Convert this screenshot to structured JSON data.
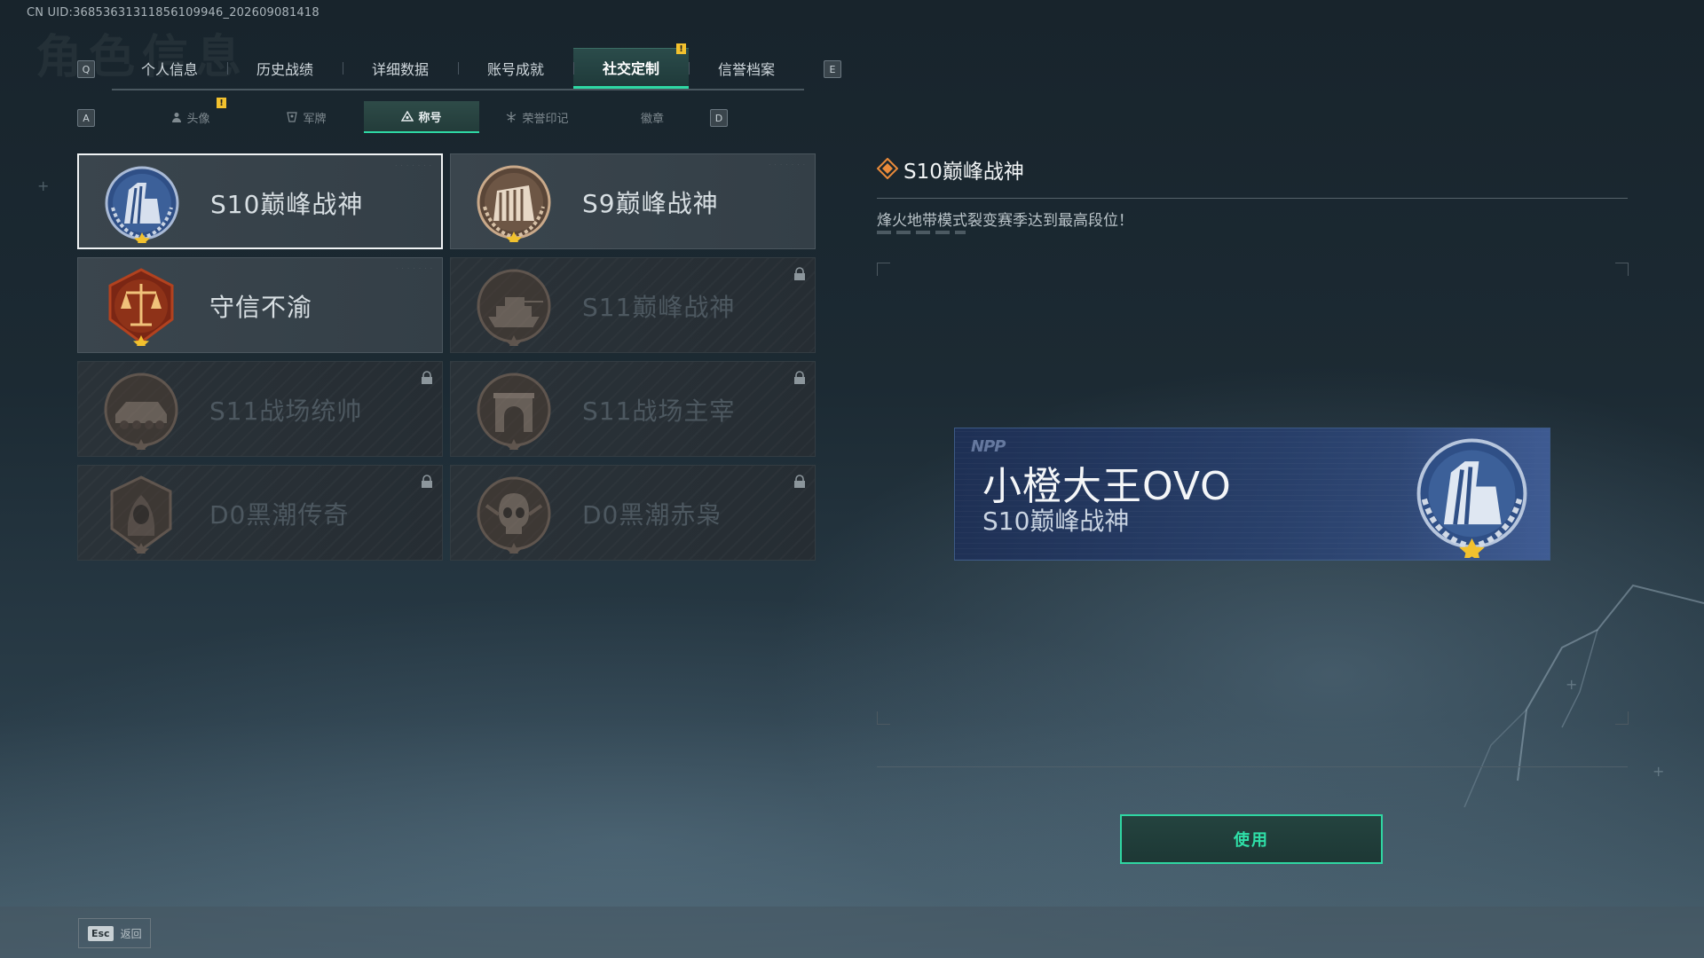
{
  "uid": "CN UID:36853631311856109946_202609081418",
  "keys": {
    "prev_main": "Q",
    "next_main": "E",
    "prev_sub": "A",
    "next_sub": "D"
  },
  "main_tabs": [
    {
      "label": "个人信息"
    },
    {
      "label": "历史战绩"
    },
    {
      "label": "详细数据"
    },
    {
      "label": "账号成就"
    },
    {
      "label": "社交定制",
      "active": true
    },
    {
      "label": "信誉档案"
    }
  ],
  "sub_tabs": [
    {
      "label": "头像",
      "icon": "person-icon"
    },
    {
      "label": "军牌",
      "icon": "dogtag-icon"
    },
    {
      "label": "称号",
      "icon": "triangle-icon",
      "active": true
    },
    {
      "label": "荣誉印记",
      "icon": "honor-icon"
    },
    {
      "label": "徽章",
      "icon": ""
    }
  ],
  "notif_mark": "!",
  "titles": [
    {
      "name": "S10巅峰战神",
      "emblem": "blue-fortress-emblem",
      "locked": false,
      "selected": true
    },
    {
      "name": "S9巅峰战神",
      "emblem": "bronze-fortress-emblem",
      "locked": false
    },
    {
      "name": "守信不渝",
      "emblem": "scales-emblem",
      "locked": false
    },
    {
      "name": "S11巅峰战神",
      "emblem": "tank-emblem",
      "locked": true
    },
    {
      "name": "S11战场统帅",
      "emblem": "apc-emblem",
      "locked": true
    },
    {
      "name": "S11战场主宰",
      "emblem": "arch-emblem",
      "locked": true
    },
    {
      "name": "D0黑潮传奇",
      "emblem": "hooded-figure-emblem",
      "locked": true
    },
    {
      "name": "D0黑潮赤枭",
      "emblem": "skull-emblem",
      "locked": true
    }
  ],
  "detail": {
    "name": "S10巅峰战神",
    "description": "烽火地带模式裂变赛季达到最高段位！"
  },
  "nameplate": {
    "logo": "NPP",
    "player": "小橙大王OVO",
    "title": "S10巅峰战神"
  },
  "use_button": "使用",
  "footer": {
    "esc_key": "Esc",
    "esc_label": "返回"
  },
  "colors": {
    "accent": "#2ed8a4",
    "notif": "#f2c12e",
    "nameplate": "#283f70"
  }
}
